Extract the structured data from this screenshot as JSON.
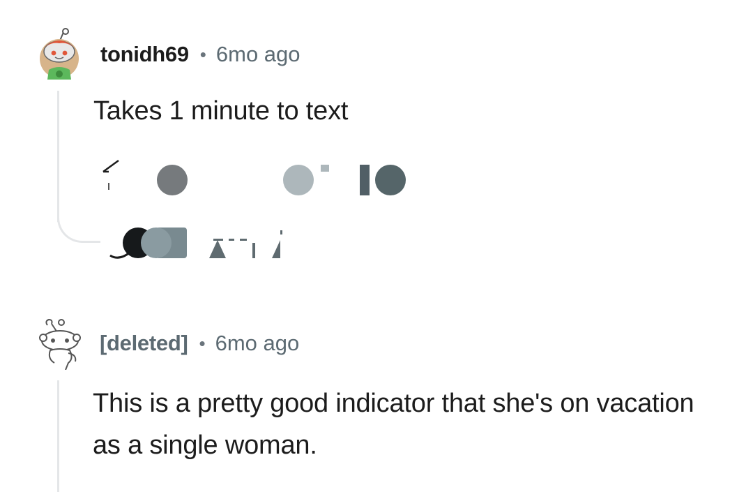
{
  "comments": [
    {
      "author": "tonidh69",
      "separator": "•",
      "time": "6mo ago",
      "body": "Takes 1 minute to text",
      "avatar_icon": "snoo-avatar-red-hair-icon"
    },
    {
      "author": "[deleted]",
      "separator": "•",
      "time": "6mo ago",
      "body": "This is a pretty good indicator that she's on vacation as a single woman.",
      "avatar_icon": "snoo-deleted-avatar-icon"
    }
  ],
  "colors": {
    "text": "#1c1c1c",
    "meta": "#5c6a72",
    "thread_line": "#e4e6e8",
    "background": "#ffffff"
  }
}
